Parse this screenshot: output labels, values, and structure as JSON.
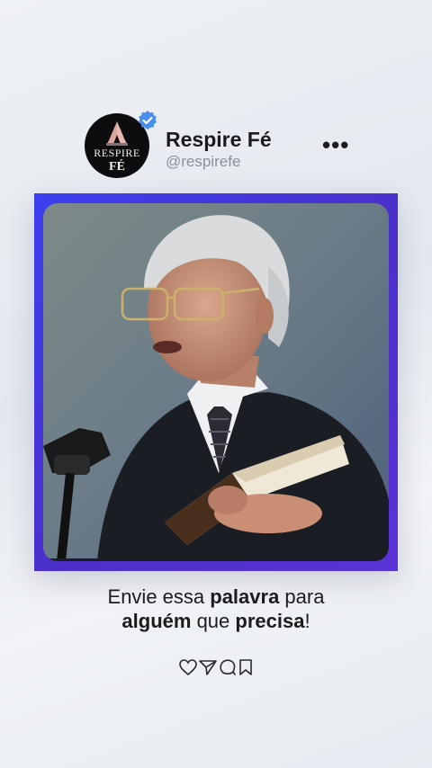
{
  "profile": {
    "avatar_line1": "RESPIRE",
    "avatar_line2": "FÉ",
    "name": "Respire Fé",
    "handle": "@respirefe",
    "more": "•••",
    "verified_color": "#4a8ef0"
  },
  "post": {
    "image_alt": "older preacher speaking at microphone holding open book",
    "frame_color": "#3f3ae6"
  },
  "caption": {
    "p1": "Envie essa ",
    "b1": "palavra",
    "p2": " para",
    "b2": "alguém",
    "p3": " que ",
    "b3": "precisa",
    "p4": "!"
  },
  "actions": {
    "icons": [
      "heart-icon",
      "send-icon",
      "comment-icon",
      "bookmark-icon"
    ]
  }
}
